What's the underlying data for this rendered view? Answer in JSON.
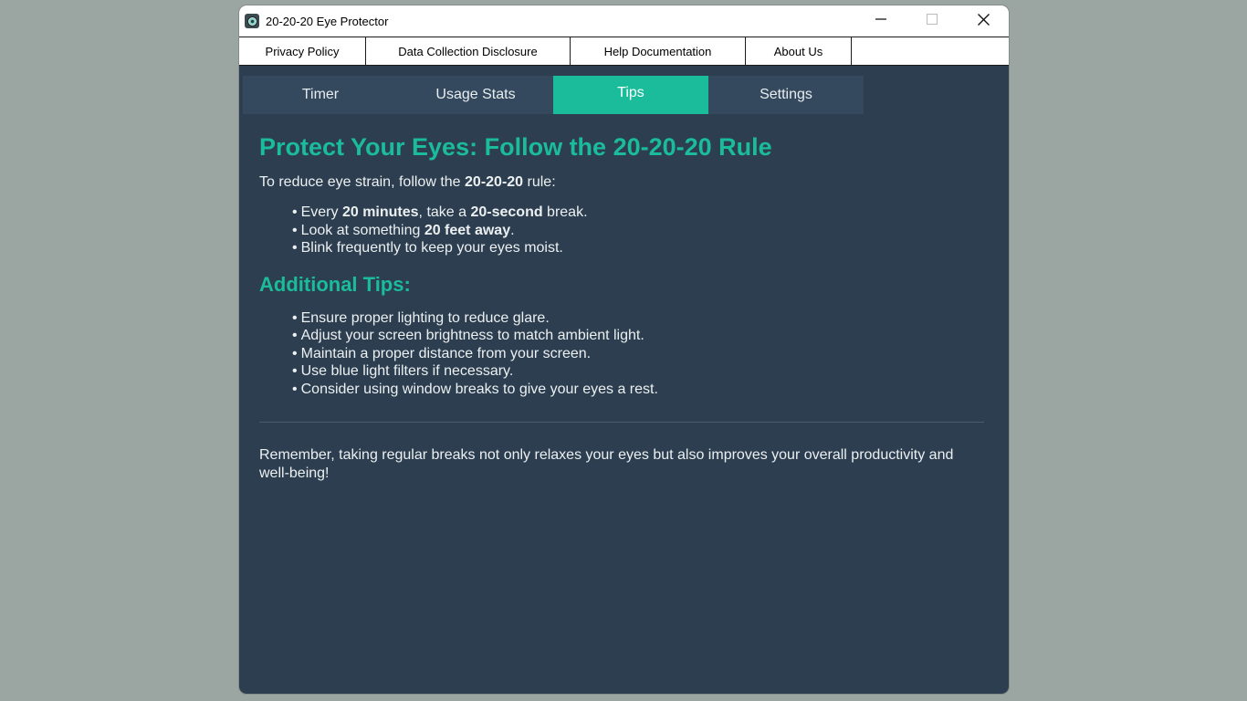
{
  "window": {
    "title": "20-20-20 Eye Protector",
    "icon": "eye-app-icon",
    "controls": {
      "minimize_icon": "minimize-icon",
      "maximize_icon": "maximize-icon",
      "close_icon": "close-icon"
    }
  },
  "menu": {
    "items": [
      {
        "label": "Privacy Policy"
      },
      {
        "label": "Data Collection Disclosure"
      },
      {
        "label": "Help Documentation"
      },
      {
        "label": "About Us"
      }
    ]
  },
  "tabs": {
    "items": [
      {
        "label": "Timer"
      },
      {
        "label": "Usage Stats"
      },
      {
        "label": "Tips"
      },
      {
        "label": "Settings"
      }
    ],
    "active": "Tips"
  },
  "tips_page": {
    "heading": "Protect Your Eyes: Follow the 20-20-20 Rule",
    "intro": {
      "pre": "To reduce eye strain, follow the ",
      "bold": "20-20-20",
      "post": " rule:"
    },
    "rule_bullets": {
      "b1": {
        "t1": "Every ",
        "b1": "20 minutes",
        "t2": ", take a ",
        "b2": "20-second",
        "t3": " break."
      },
      "b2": {
        "t1": "Look at something ",
        "b1": "20 feet away",
        "t2": "."
      },
      "b3": {
        "t1": "Blink frequently to keep your eyes moist."
      }
    },
    "additional_heading": "Additional Tips:",
    "additional_tips": [
      "Ensure proper lighting to reduce glare.",
      "Adjust your screen brightness to match ambient light.",
      "Maintain a proper distance from your screen.",
      "Use blue light filters if necessary.",
      "Consider using window breaks to give your eyes a rest."
    ],
    "closing": "Remember, taking regular breaks not only relaxes your eyes but also improves your overall productivity and well-being!"
  },
  "colors": {
    "background": "#2c3e50",
    "tab": "#34495e",
    "accent": "#1abc9c",
    "text": "#ecf0f1",
    "desktop": "#9ba6a3"
  }
}
